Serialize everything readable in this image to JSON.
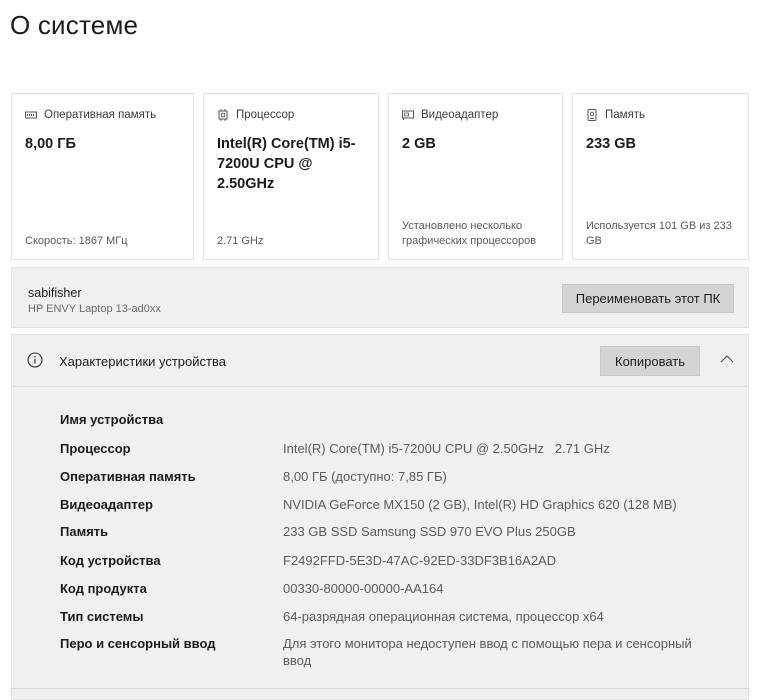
{
  "page": {
    "title": "О системе"
  },
  "cards": [
    {
      "icon": "memory-icon",
      "label": "Оперативная память",
      "value": "8,00 ГБ",
      "footer": "Скорость: 1867 МГц"
    },
    {
      "icon": "processor-icon",
      "label": "Процессор",
      "value": "Intel(R) Core(TM) i5-7200U CPU @ 2.50GHz",
      "footer": "2.71 GHz"
    },
    {
      "icon": "display-adapter-icon",
      "label": "Видеоадаптер",
      "value": "2 GB",
      "footer": "Установлено несколько графических процессоров"
    },
    {
      "icon": "storage-icon",
      "label": "Память",
      "value": "233 GB",
      "footer": "Используется 101 GB из 233 GB"
    }
  ],
  "device": {
    "name": "sabifisher",
    "model": "HP ENVY Laptop 13-ad0xx",
    "rename_label": "Переименовать этот ПК"
  },
  "specs": {
    "title": "Характеристики устройства",
    "copy_label": "Копировать",
    "rows": [
      {
        "label": "Имя устройства",
        "value": ""
      },
      {
        "label": "Процессор",
        "value": "Intel(R) Core(TM) i5-7200U CPU @ 2.50GHz   2.71 GHz"
      },
      {
        "label": "Оперативная память",
        "value": "8,00 ГБ (доступно: 7,85 ГБ)"
      },
      {
        "label": "Видеоадаптер",
        "value": "NVIDIA GeForce MX150 (2 GB), Intel(R) HD Graphics 620 (128 MB)"
      },
      {
        "label": "Память",
        "value": "233 GB SSD Samsung SSD 970 EVO Plus 250GB"
      },
      {
        "label": "Код устройства",
        "value": "F2492FFD-5E3D-47AC-92ED-33DF3B16A2AD"
      },
      {
        "label": "Код продукта",
        "value": "00330-80000-00000-AA164"
      },
      {
        "label": "Тип системы",
        "value": "64-разрядная операционная система, процессор x64"
      },
      {
        "label": "Перо и сенсорный ввод",
        "value": "Для этого монитора недоступен ввод с помощью пера и сенсорный ввод"
      }
    ]
  }
}
